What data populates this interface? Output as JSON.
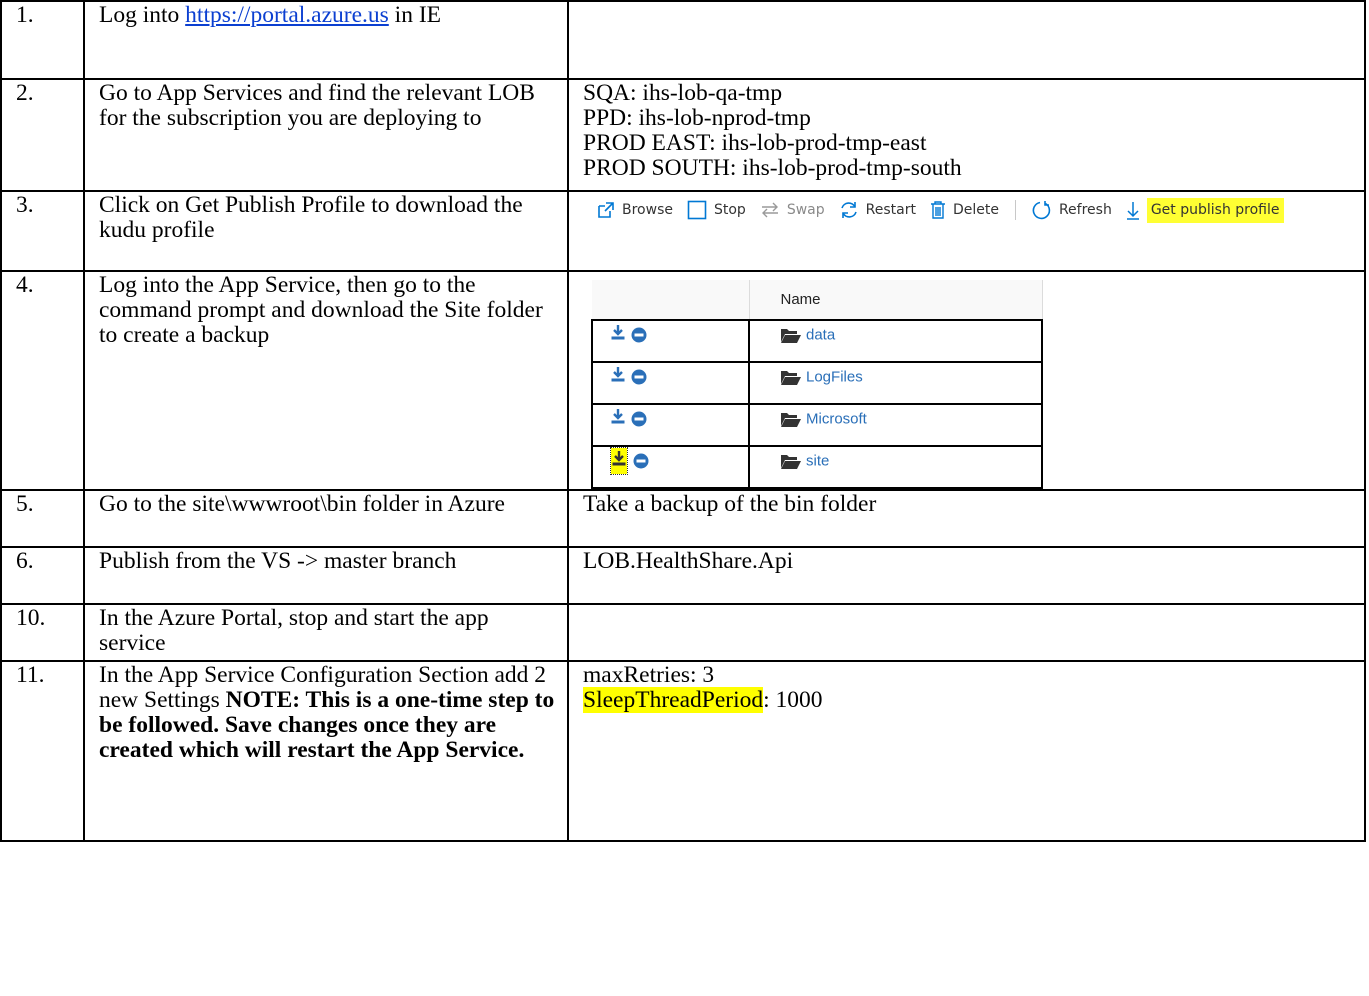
{
  "rows": [
    {
      "num": "1.",
      "desc_lines": [
        "Log into ",
        "https://portal.azure.us",
        " in IE"
      ],
      "note": []
    },
    {
      "num": "2.",
      "desc": "Go to App Services and find the relevant LOB for the subscription you are deploying to",
      "note": [
        "SQA: ihs-lob-qa-tmp",
        "PPD: ihs-lob-nprod-tmp",
        "PROD EAST: ihs-lob-prod-tmp-east",
        "PROD SOUTH: ihs-lob-prod-tmp-south"
      ]
    },
    {
      "num": "3.",
      "desc": "Click on Get Publish Profile to download the kudu profile",
      "toolbar": {
        "browse": "Browse",
        "stop": "Stop",
        "swap": "Swap",
        "restart": "Restart",
        "delete": "Delete",
        "refresh": "Refresh",
        "get_publish_profile": "Get publish profile"
      }
    },
    {
      "num": "4.",
      "desc": "Log into the App Service, then go to the command prompt and download the Site folder to create a backup",
      "filelist": {
        "header": "Name",
        "items": [
          "data",
          "LogFiles",
          "Microsoft",
          "site"
        ]
      }
    },
    {
      "num": "5.",
      "desc": "Go to the site\\wwwroot\\bin folder in Azure",
      "note": [
        "Take a backup of the bin folder"
      ]
    },
    {
      "num": "6.",
      "desc": "Publish from the VS -> master branch",
      "note": [
        "LOB.HealthShare.Api"
      ]
    },
    {
      "num": "10.",
      "desc": "In the Azure Portal, stop and start the app service",
      "note": []
    },
    {
      "num": "11.",
      "desc": "In the App Service Configuration Section add 2 new Settings",
      "desc_bold": "NOTE: This is a one-time step to be followed.  Save changes once they are created which will restart the App Service.",
      "note_lines": [
        {
          "key": "maxRetries",
          "value": ": 3"
        },
        {
          "key": "SleepThreadPeriod",
          "value": ": 1000"
        }
      ]
    }
  ],
  "colors": {
    "highlight": "#ffff00",
    "link": "#0b3fd1",
    "azure_icon_blue": "#0078d4",
    "kudu_icon_blue": "#2a6fb8"
  }
}
